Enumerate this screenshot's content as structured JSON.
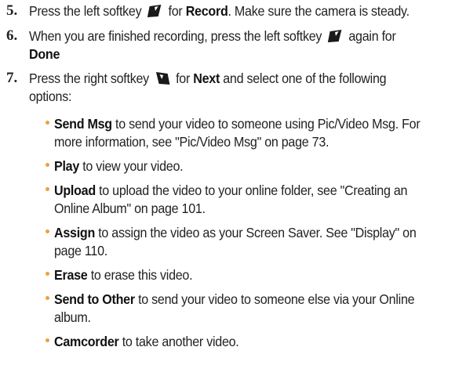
{
  "steps": [
    {
      "number": "5.",
      "pre": "Press the left softkey ",
      "key_icon": "left-softkey-icon",
      "mid": " for ",
      "bold": "Record",
      "post": ". Make sure the camera is steady."
    },
    {
      "number": "6.",
      "pre": "When you are finished recording, press the left softkey ",
      "key_icon": "left-softkey-icon",
      "mid": " again for",
      "bold": "Done"
    },
    {
      "number": "7.",
      "pre": "Press the right softkey ",
      "key_icon": "right-softkey-icon",
      "mid": " for ",
      "bold": "Next",
      "post": " and select one of the following",
      "line2": "options:"
    }
  ],
  "options": [
    {
      "bold": "Send Msg",
      "line1": " to send your video to someone using Pic/Video Msg. For",
      "line2": "more information, see \"Pic/Video Msg\" on page 73."
    },
    {
      "bold": "Play",
      "line1": " to view your video."
    },
    {
      "bold": "Upload",
      "line1": " to upload the video to your online folder, see \"Creating an",
      "line2": "Online Album\" on page 101."
    },
    {
      "bold": "Assign",
      "line1": " to assign the video as your Screen Saver. See \"Display\" on",
      "line2": "page 110."
    },
    {
      "bold": "Erase",
      "line1": " to erase this video."
    },
    {
      "bold": "Send to Other",
      "line1": " to send your video to someone else via your Online",
      "line2": "album."
    },
    {
      "bold": "Camcorder",
      "line1": " to take another video."
    }
  ],
  "colors": {
    "bullet": "#e8a33c",
    "text": "#222222"
  }
}
